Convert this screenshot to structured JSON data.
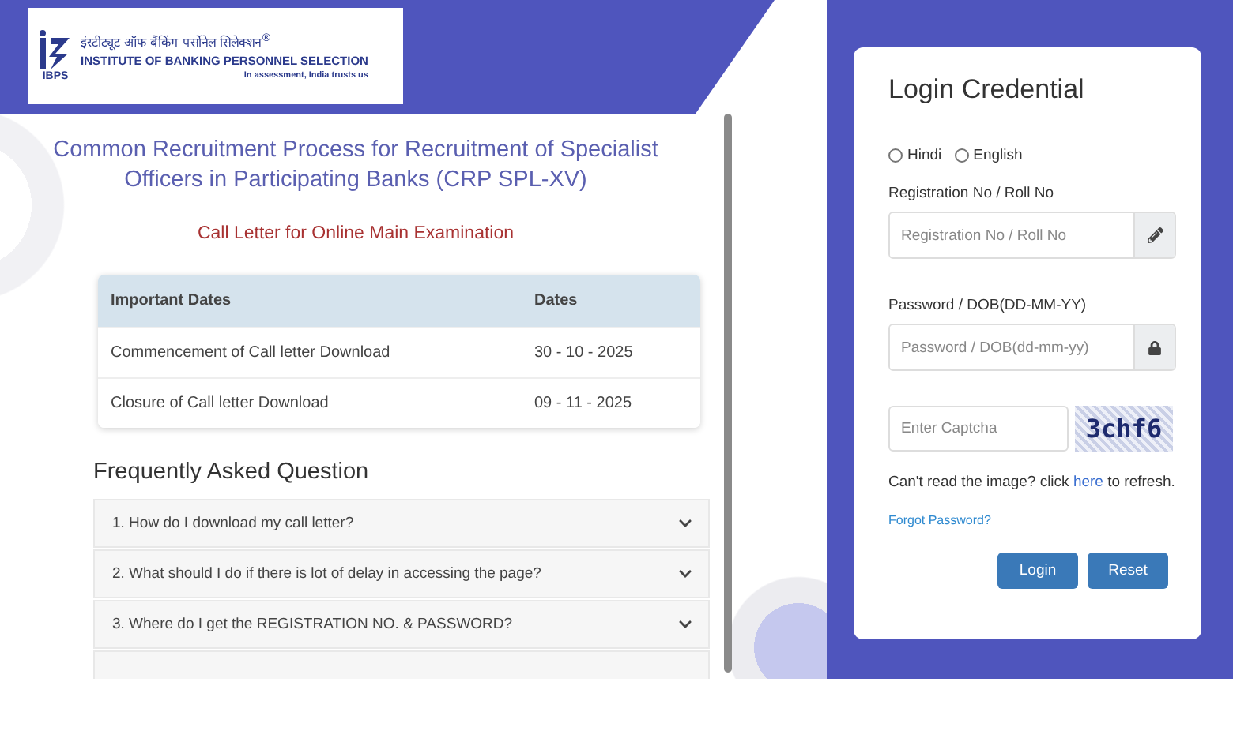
{
  "header": {
    "logo_mark": "IBPS",
    "hindi_name": "इंस्टीट्यूट ऑफ बैंकिंग पर्सोनेल सिलेक्शन",
    "registered": "®",
    "english_name": "INSTITUTE OF BANKING PERSONNEL SELECTION",
    "tagline": "In assessment, India trusts us"
  },
  "title": "Common Recruitment Process for Recruitment of Specialist Officers in Participating Banks (CRP SPL-XV)",
  "subtitle": "Call Letter for Online Main Examination",
  "dates_table": {
    "columns": [
      "Important Dates",
      "Dates"
    ],
    "rows": [
      [
        "Commencement of Call letter Download",
        "30 - 10 - 2025"
      ],
      [
        "Closure of Call letter Download",
        "09 - 11 - 2025"
      ]
    ]
  },
  "faq": {
    "heading": "Frequently Asked Question",
    "items": [
      {
        "question": "1. How do I download my call letter?",
        "expanded": false
      },
      {
        "question": "2. What should I do if there is lot of delay in accessing the page?",
        "expanded": false
      },
      {
        "question": "3. Where do I get the REGISTRATION NO. & PASSWORD?",
        "expanded": false
      }
    ]
  },
  "login": {
    "title": "Login Credential",
    "languages": [
      {
        "label": "Hindi",
        "selected": false
      },
      {
        "label": "English",
        "selected": false
      }
    ],
    "registration_label": "Registration No / Roll No",
    "registration_placeholder": "Registration No / Roll No",
    "password_label": "Password / DOB(DD-MM-YY)",
    "password_placeholder": "Password / DOB(dd-mm-yy)",
    "captcha_placeholder": "Enter Captcha",
    "captcha_text": "3chf6",
    "refresh_before": "Can't read the image? click",
    "refresh_link": "here",
    "refresh_after": "to refresh.",
    "forgot": "Forgot Password?",
    "buttons": [
      "Login",
      "Reset"
    ]
  }
}
